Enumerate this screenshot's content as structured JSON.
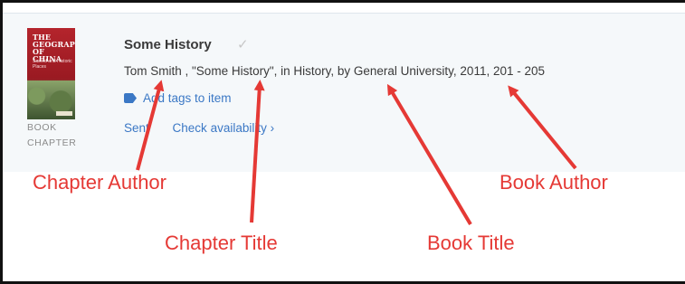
{
  "record": {
    "type_line1": "BOOK",
    "type_line2": "CHAPTER",
    "cover": {
      "title_text": "THE GEOGRAPHY OF CHINA",
      "subtitle_text": "Sacred and Historic Places"
    },
    "title": "Some History",
    "citation": "Tom Smith , \"Some History\", in History, by General University, 2011, 201 - 205",
    "add_tags_label": "Add tags to item",
    "sent_label": "Sent",
    "check_availability_label": "Check availability ›"
  },
  "annotations": {
    "chapter_author": "Chapter Author",
    "chapter_title": "Chapter Title",
    "book_title": "Book Title",
    "book_author": "Book Author"
  },
  "colors": {
    "arrow": "#e53935",
    "link": "#3b78c5",
    "card_background": "#f5f8fa"
  },
  "icons": {
    "tag": "tag-icon",
    "verified": "check-icon"
  }
}
